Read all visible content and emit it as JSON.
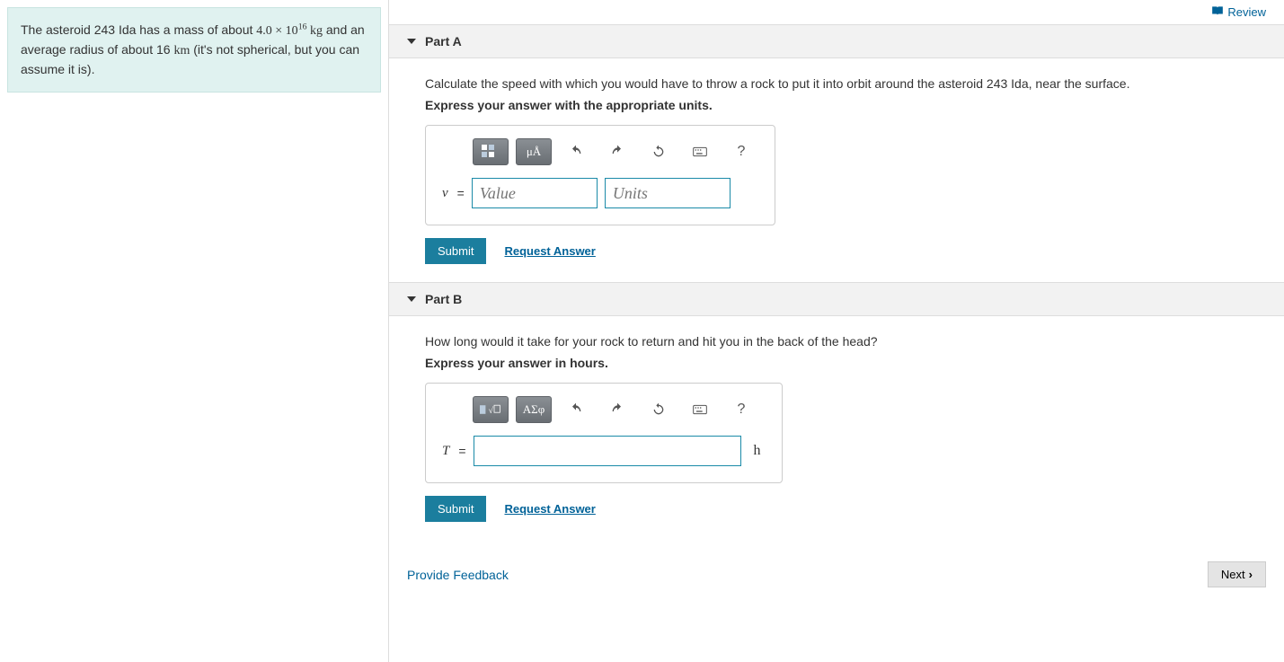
{
  "problem": {
    "prefix": "The asteroid 243 Ida has a mass of about ",
    "mass": "4.0 × 10",
    "mass_exp": "16",
    "mass_unit": " kg",
    "mid1": " and an average radius of about 16 ",
    "radius_unit": "km",
    "suffix": " (it's not spherical, but you can assume it is)."
  },
  "review": "Review",
  "partA": {
    "title": "Part A",
    "prompt": "Calculate the speed with which you would have to throw a rock to put it into orbit around the asteroid 243 Ida, near the surface.",
    "hint": "Express your answer with the appropriate units.",
    "var": "v",
    "value_ph": "Value",
    "units_ph": "Units",
    "toolbar_units": "μÅ"
  },
  "partB": {
    "title": "Part B",
    "prompt": "How long would it take for your rock to return and hit you in the back of the head?",
    "hint": "Express your answer in hours.",
    "var": "T",
    "unit_suffix": "h",
    "toolbar_greek": "ΑΣφ"
  },
  "submit": "Submit",
  "request": "Request Answer",
  "feedback": "Provide Feedback",
  "next": "Next",
  "help": "?"
}
